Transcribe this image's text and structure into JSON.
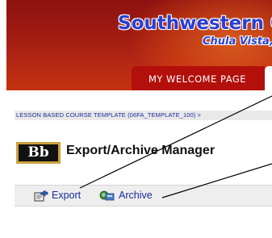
{
  "header": {
    "school_name": "Southwestern C",
    "school_location": "Chula Vista,",
    "tab_label": "MY WELCOME PAGE",
    "colors": {
      "banner": "#a11b12",
      "tab": "#b30f0b",
      "school_text": "#2b3fd1"
    }
  },
  "breadcrumb": "LESSON BASED COURSE TEMPLATE (06FA_TEMPLATE_100) >",
  "logo": "Bb",
  "page_title": "Export/Archive Manager",
  "actions": {
    "export": {
      "label": "Export",
      "icon": "export-icon"
    },
    "archive": {
      "label": "Archive",
      "icon": "archive-icon"
    }
  }
}
